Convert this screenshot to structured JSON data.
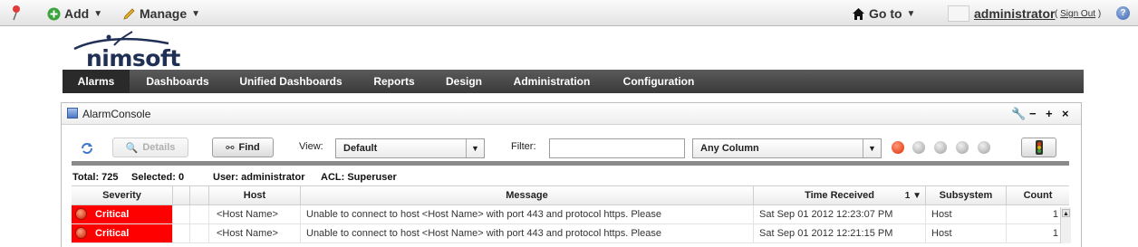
{
  "topbar": {
    "add_label": "Add",
    "manage_label": "Manage",
    "goto_label": "Go to",
    "username": "administrator",
    "signout_open": "(",
    "signout_label": "Sign Out",
    "signout_close": ")",
    "help_glyph": "?",
    "icons": {
      "pin": "pushpin-icon",
      "add": "plus-circle-icon",
      "manage": "pencil-icon",
      "goto": "home-icon",
      "help": "help-icon"
    }
  },
  "logo": {
    "text": "nimsoft"
  },
  "nav": {
    "items": [
      {
        "label": "Alarms",
        "active": true
      },
      {
        "label": "Dashboards"
      },
      {
        "label": "Unified Dashboards"
      },
      {
        "label": "Reports"
      },
      {
        "label": "Design"
      },
      {
        "label": "Administration"
      },
      {
        "label": "Configuration"
      }
    ]
  },
  "portlet": {
    "title": "AlarmConsole",
    "controls": {
      "wrench": "🔧",
      "minimize": "−",
      "maximize": "+",
      "close": "×"
    }
  },
  "controls": {
    "details_label": "Details",
    "find_label": "Find",
    "view_label": "View:",
    "view_value": "Default",
    "filter_label": "Filter:",
    "filter_value": "",
    "column_value": "Any Column"
  },
  "status": {
    "total": "Total: 725",
    "selected": "Selected: 0",
    "user": "User: administrator",
    "acl": "ACL: Superuser"
  },
  "table": {
    "columns": [
      "Severity",
      "",
      "",
      "Host",
      "Message",
      "Time Received",
      "Subsystem",
      "Count"
    ],
    "sort_indicator": "1 ▼",
    "rows": [
      {
        "severity": "Critical",
        "host": "<Host Name>",
        "message": "Unable to connect to host  <Host Name>  with port 443 and protocol https. Please",
        "time": "Sat Sep 01 2012 12:23:07 PM",
        "subsystem": "Host",
        "count": "1"
      },
      {
        "severity": "Critical",
        "host": "<Host Name>",
        "message": "Unable to connect to host  <Host Name>  with port 443 and protocol https. Please",
        "time": "Sat Sep 01 2012 12:21:15 PM",
        "subsystem": "Host",
        "count": "1"
      }
    ]
  },
  "colors": {
    "critical": "#ff0000",
    "nav_bg": "#444444"
  }
}
